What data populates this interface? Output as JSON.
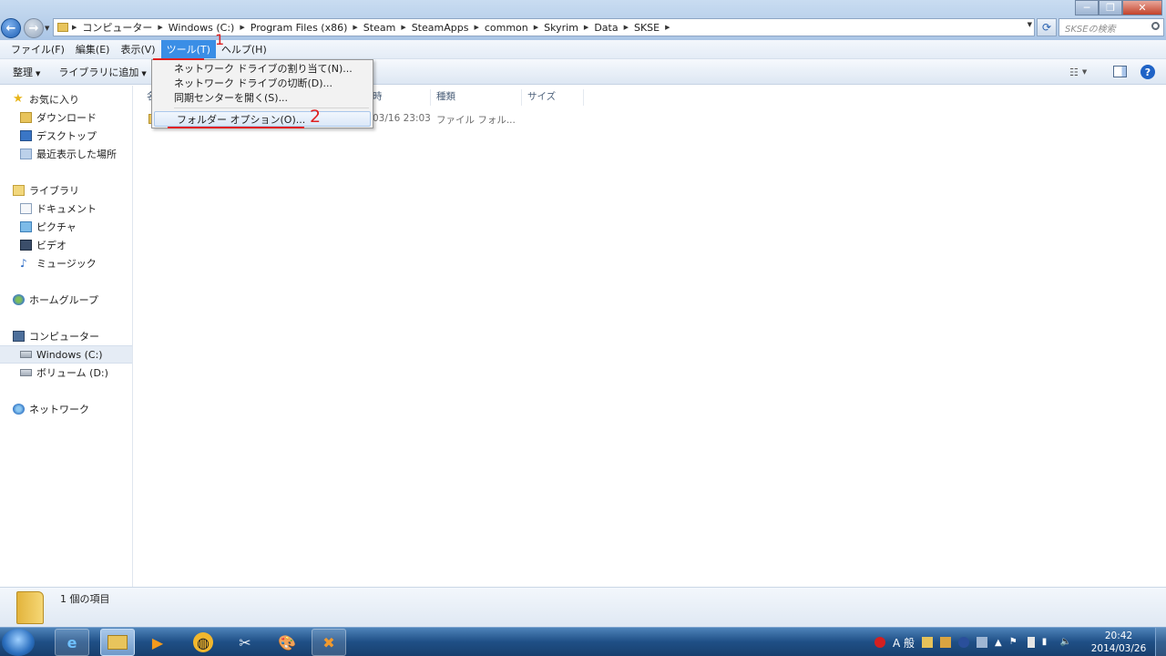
{
  "address": {
    "segments": [
      "コンピューター",
      "Windows (C:)",
      "Program Files (x86)",
      "Steam",
      "SteamApps",
      "common",
      "Skyrim",
      "Data",
      "SKSE"
    ],
    "search_placeholder": "SKSEの検索"
  },
  "window": {
    "minimize": "─",
    "maximize": "❐",
    "close": "✕"
  },
  "menubar": {
    "file": "ファイル(F)",
    "edit": "編集(E)",
    "view": "表示(V)",
    "tools": "ツール(T)",
    "help": "ヘルプ(H)"
  },
  "commandbar": {
    "organize": "整理",
    "add_to_library": "ライブラリに追加"
  },
  "dropdown": {
    "map_drive": "ネットワーク ドライブの割り当て(N)...",
    "disconnect_drive": "ネットワーク ドライブの切断(D)...",
    "sync_center": "同期センターを開く(S)...",
    "folder_options": "フォルダー オプション(O)..."
  },
  "annotations": {
    "step1": "1",
    "step2": "2"
  },
  "nav": {
    "favorites": "お気に入り",
    "downloads": "ダウンロード",
    "desktop": "デスクトップ",
    "recent": "最近表示した場所",
    "libraries": "ライブラリ",
    "documents": "ドキュメント",
    "pictures": "ピクチャ",
    "videos": "ビデオ",
    "music": "ミュージック",
    "homegroup": "ホームグループ",
    "computer": "コンピューター",
    "drive_c": "Windows (C:)",
    "drive_d": "ボリューム (D:)",
    "network": "ネットワーク"
  },
  "columns": {
    "name_partial": "名",
    "date_partial": "時",
    "type": "種類",
    "size": "サイズ"
  },
  "files": [
    {
      "date_partial": "03/16 23:03",
      "type": "ファイル フォル..."
    }
  ],
  "status": {
    "count": "1 個の項目"
  },
  "taskbar": {
    "ime": "A 般",
    "time": "20:42",
    "date": "2014/03/26"
  }
}
